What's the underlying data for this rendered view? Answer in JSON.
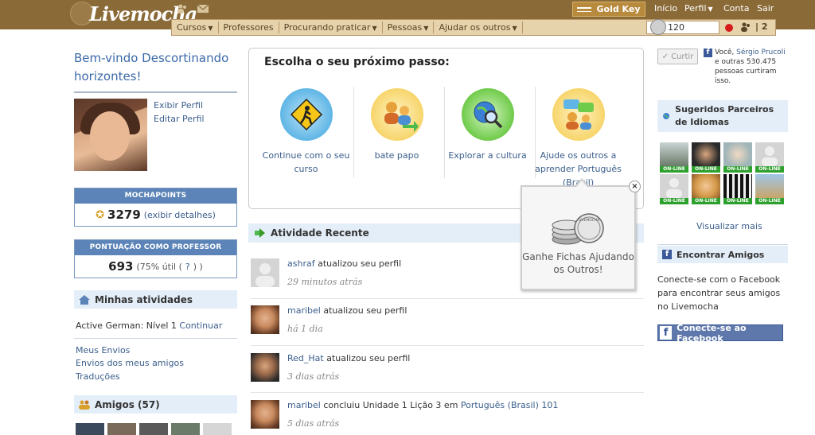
{
  "brand": {
    "logo_text": "Livemocha"
  },
  "topbar": {
    "gold_key": "Gold Key",
    "links": [
      "Início",
      "Perfil",
      "Conta",
      "Sair"
    ]
  },
  "navbar": {
    "items": [
      "Cursos",
      "Professores",
      "Procurando praticar",
      "Pessoas",
      "Ajudar os outros"
    ],
    "coins": "120",
    "friend_requests": "2"
  },
  "left": {
    "welcome": "Bem-vindo Descortinando horizontes!",
    "view_profile": "Exibir Perfil",
    "edit_profile": "Editar Perfil",
    "mochapoints": {
      "header": "MOCHAPOINTS",
      "value": "3279",
      "details": "(exibir detalhes)"
    },
    "teacher_score": {
      "header": "PONTUAÇÃO COMO PROFESSOR",
      "value": "693",
      "useful": "(75% útil (",
      "help": "?",
      "close": ") )"
    },
    "activities": {
      "title": "Minhas atividades",
      "course": "Active German: Nível 1",
      "continue": "Continuar",
      "links": [
        "Meus Envios",
        "Envios dos meus amigos",
        "Traduções"
      ]
    },
    "friends_title": "Amigos (57)"
  },
  "next_step": {
    "title": "Escolha o seu próximo passo:",
    "steps": [
      {
        "label": "Continue com o seu curso",
        "icon": "course-sign-icon"
      },
      {
        "label": "bate papo",
        "icon": "chat-people-icon"
      },
      {
        "label": "Explorar a cultura",
        "icon": "globe-search-icon"
      },
      {
        "label": "Ajude os outros a aprender Português (Brasil)",
        "icon": "help-others-icon"
      }
    ]
  },
  "recent": {
    "title": "Atividade Recente",
    "items": [
      {
        "user": "ashraf",
        "action": " atualizou seu perfil",
        "extra": "",
        "time": "29 minutos atrás"
      },
      {
        "user": "maribel",
        "action": " atualizou seu perfil",
        "extra": "",
        "time": "há 1 dia"
      },
      {
        "user": "Red_Hat",
        "action": " atualizou seu perfil",
        "extra": "",
        "time": "3 dias atrás"
      },
      {
        "user": "maribel",
        "action": " concluiu Unidade 1 Lição 3 em ",
        "extra": "Português (Brasil) 101",
        "time": "5 dias atrás"
      }
    ]
  },
  "popup": {
    "coin_text": "LIVEMOCHA",
    "text": "Ganhe Fichas Ajudando os Outros!",
    "close": "×"
  },
  "right": {
    "like_button": "Curtir",
    "like_prefix": "Você, ",
    "like_name": "Sérgio Prucoli",
    "like_suffix": " e outras 530.475 pessoas curtiram isso.",
    "partners_title": "Sugeridos Parceiros de Idiomas",
    "online_label": "ON-LINE",
    "see_more": "Visualizar mais",
    "find_friends_title": "Encontrar Amigos",
    "fb_text": "Conecte-se com o Facebook para encontrar seus amigos no Livemocha",
    "fb_button": "Conecte-se ao Facebook"
  }
}
